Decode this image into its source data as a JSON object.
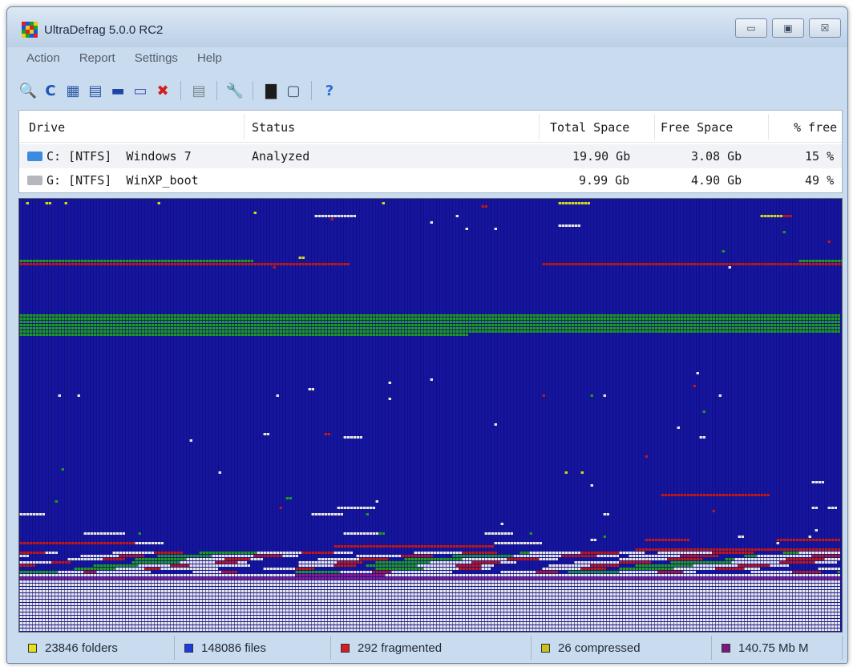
{
  "window": {
    "title": "UltraDefrag 5.0.0 RC2"
  },
  "controls": {
    "minimize": "▭",
    "maximize": "▣",
    "close": "☒"
  },
  "menu": [
    "Action",
    "Report",
    "Settings",
    "Help"
  ],
  "toolbar": [
    {
      "icon": "analyze-icon",
      "glyph": "🔍",
      "color": "#2a62c2"
    },
    {
      "icon": "repeat-icon",
      "glyph": "C",
      "color": "#1a54b6"
    },
    {
      "icon": "defragment-icon",
      "glyph": "▦",
      "color": "#2d5aa5"
    },
    {
      "icon": "quick-optimize-icon",
      "glyph": "▤",
      "color": "#2d5aa5"
    },
    {
      "icon": "full-optimize-icon",
      "glyph": "▬",
      "color": "#1f44a8"
    },
    {
      "icon": "optimize-mft-icon",
      "glyph": "▭",
      "color": "#4856b0"
    },
    {
      "icon": "stop-icon",
      "glyph": "✖",
      "color": "#d11f1f"
    },
    {
      "sep": true
    },
    {
      "icon": "report-icon",
      "glyph": "▤",
      "color": "#7b8793"
    },
    {
      "sep": true
    },
    {
      "icon": "preferences-icon",
      "glyph": "🔧",
      "color": "#d2861c"
    },
    {
      "sep": true
    },
    {
      "icon": "boot-time-icon",
      "glyph": "▇",
      "color": "#1c1c1c"
    },
    {
      "icon": "boot-script-icon",
      "glyph": "▢",
      "color": "#3e4e66"
    },
    {
      "sep": true
    },
    {
      "icon": "help-icon",
      "glyph": "?",
      "color": "#2f6ed8"
    }
  ],
  "drives": {
    "headers": {
      "drive": "Drive",
      "status": "Status",
      "total": "Total Space",
      "free": "Free Space",
      "pfree": "% free"
    },
    "rows": [
      {
        "drive": "C: [NTFS]  Windows 7",
        "status": "Analyzed",
        "total": "19.90 Gb",
        "free": "3.08 Gb",
        "pfree": "15 %",
        "icon_color": "#3c8be0"
      },
      {
        "drive": "G: [NTFS]  WinXP_boot",
        "status": "",
        "total": "9.99 Gb",
        "free": "4.90 Gb",
        "pfree": "49 %",
        "icon_color": "#b4b8bd"
      }
    ]
  },
  "cluster_map": {
    "colors": {
      "free": "#1515a0",
      "grid": "#0d0d70",
      "system": "#1e9c1e",
      "fragmented": "#c01818",
      "unfragmented": "#e6e6e6",
      "compressed": "#d6d622",
      "mft": "#8a1c90"
    }
  },
  "status": [
    {
      "label": "23846 folders",
      "color": "#e8e01e"
    },
    {
      "label": "148086 files",
      "color": "#1a3ce0"
    },
    {
      "label": "292 fragmented",
      "color": "#d42020"
    },
    {
      "label": "26 compressed",
      "color": "#c8c020"
    },
    {
      "label": "140.75 Mb M",
      "color": "#7a1a80"
    }
  ]
}
